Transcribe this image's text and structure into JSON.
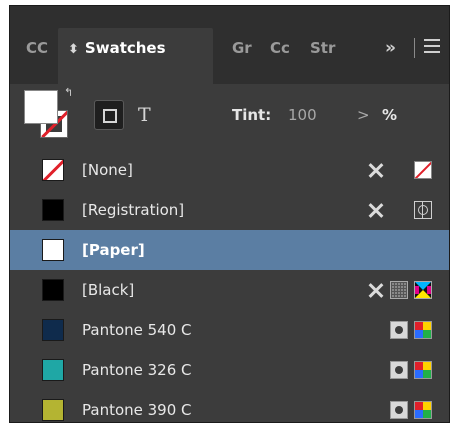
{
  "tabs": {
    "cc": "CC",
    "swatches": "Swatches",
    "swatches_sort_glyph": "⬍",
    "gradient": "Gr",
    "color": "Cc",
    "stroke": "Str",
    "overflow": "»"
  },
  "controls": {
    "tint_label": "Tint:",
    "tint_value": "100",
    "tint_arrow": ">",
    "tint_unit": "%",
    "text_button": "T",
    "swap_glyph": "↰"
  },
  "swatches": [
    {
      "name": "[None]",
      "color": "none",
      "icons": [
        "noedit-icon",
        "none-type-icon"
      ]
    },
    {
      "name": "[Registration]",
      "color": "#000000",
      "icons": [
        "noedit-icon",
        "registration-icon"
      ]
    },
    {
      "name": "[Paper]",
      "color": "#ffffff",
      "icons": [],
      "selected": true
    },
    {
      "name": "[Black]",
      "color": "#000000",
      "icons": [
        "noedit-icon",
        "pattern-icon",
        "process-icon"
      ]
    },
    {
      "name": "Pantone 540 C",
      "color": "#0f2b4c",
      "icons": [
        "spot-icon",
        "colormode-icon"
      ]
    },
    {
      "name": "Pantone 326 C",
      "color": "#1fa7a5",
      "icons": [
        "spot-icon",
        "colormode-icon"
      ]
    },
    {
      "name": "Pantone 390 C",
      "color": "#b4b432",
      "icons": [
        "spot-icon",
        "colormode-icon"
      ]
    }
  ],
  "colors": {
    "panel_bg": "#3c3c3c",
    "selection": "#5b7ea3",
    "none_slash": "#e0202a"
  }
}
